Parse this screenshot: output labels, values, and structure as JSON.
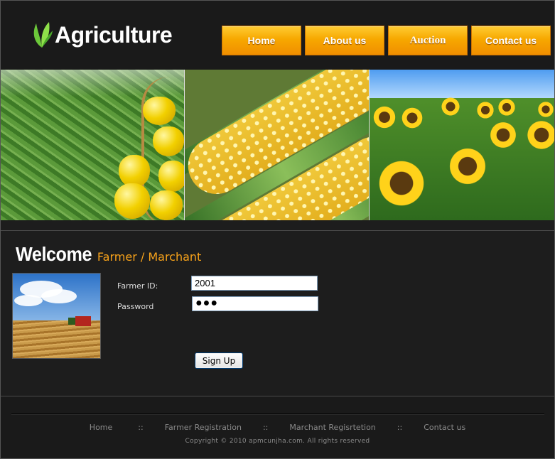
{
  "brand": {
    "name": "Agriculture",
    "logo_icon": "leaf-icon",
    "accent": "#f7a21a"
  },
  "nav": {
    "items": [
      {
        "label": "Home"
      },
      {
        "label": "About us"
      },
      {
        "label": "Auction"
      },
      {
        "label": "Contact us"
      }
    ]
  },
  "banner": {
    "panels": [
      "green beans and yellow peppers",
      "corn cobs",
      "sunflower field"
    ]
  },
  "welcome": {
    "title": "Welcome",
    "subtitle": "Farmer / Marchant"
  },
  "form": {
    "farmer_id_label": "Farmer ID:",
    "farmer_id_value": "2001",
    "password_label": "Password",
    "password_value": "●●●",
    "submit_label": "Sign Up"
  },
  "footer": {
    "links": [
      {
        "label": "Home"
      },
      {
        "label": "Farmer Registration"
      },
      {
        "label": "Marchant Regisrtetion"
      },
      {
        "label": "Contact us"
      }
    ],
    "separator": "::",
    "copyright": "Copyright © 2010 apmcunjha.com. All rights reserved"
  }
}
